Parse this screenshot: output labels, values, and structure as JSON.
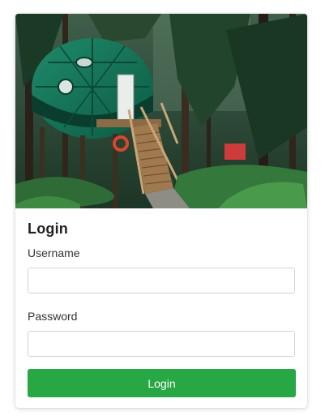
{
  "login_card": {
    "title": "Login",
    "username_label": "Username",
    "username_value": "",
    "password_label": "Password",
    "password_value": "",
    "submit_label": "Login",
    "accent_color": "#28a745",
    "hero_image": "dome treehouse in forest"
  }
}
